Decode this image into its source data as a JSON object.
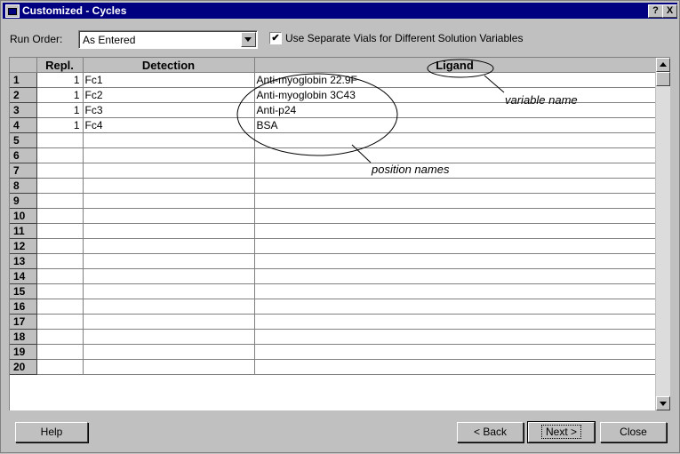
{
  "window": {
    "title": "Customized - Cycles",
    "help_btn": "?",
    "close_btn": "X"
  },
  "run_order": {
    "label": "Run Order:",
    "value": "As Entered"
  },
  "separate_vials": {
    "checked": true,
    "mark": "✔",
    "label": "Use Separate Vials for Different Solution Variables"
  },
  "table": {
    "headers": [
      "",
      "Repl.",
      "Detection",
      "Ligand"
    ],
    "rows": [
      {
        "n": "1",
        "repl": "1",
        "detection": "Fc1",
        "ligand": "Anti-myoglobin 22.9F"
      },
      {
        "n": "2",
        "repl": "1",
        "detection": "Fc2",
        "ligand": "Anti-myoglobin 3C43"
      },
      {
        "n": "3",
        "repl": "1",
        "detection": "Fc3",
        "ligand": "Anti-p24"
      },
      {
        "n": "4",
        "repl": "1",
        "detection": "Fc4",
        "ligand": "BSA"
      },
      {
        "n": "5",
        "repl": "",
        "detection": "",
        "ligand": ""
      },
      {
        "n": "6",
        "repl": "",
        "detection": "",
        "ligand": ""
      },
      {
        "n": "7",
        "repl": "",
        "detection": "",
        "ligand": ""
      },
      {
        "n": "8",
        "repl": "",
        "detection": "",
        "ligand": ""
      },
      {
        "n": "9",
        "repl": "",
        "detection": "",
        "ligand": ""
      },
      {
        "n": "10",
        "repl": "",
        "detection": "",
        "ligand": ""
      },
      {
        "n": "11",
        "repl": "",
        "detection": "",
        "ligand": ""
      },
      {
        "n": "12",
        "repl": "",
        "detection": "",
        "ligand": ""
      },
      {
        "n": "13",
        "repl": "",
        "detection": "",
        "ligand": ""
      },
      {
        "n": "14",
        "repl": "",
        "detection": "",
        "ligand": ""
      },
      {
        "n": "15",
        "repl": "",
        "detection": "",
        "ligand": ""
      },
      {
        "n": "16",
        "repl": "",
        "detection": "",
        "ligand": ""
      },
      {
        "n": "17",
        "repl": "",
        "detection": "",
        "ligand": ""
      },
      {
        "n": "18",
        "repl": "",
        "detection": "",
        "ligand": ""
      },
      {
        "n": "19",
        "repl": "",
        "detection": "",
        "ligand": ""
      },
      {
        "n": "20",
        "repl": "",
        "detection": "",
        "ligand": ""
      }
    ]
  },
  "annotations": {
    "variable_name": "variable name",
    "position_names": "position names"
  },
  "buttons": {
    "help": "Help",
    "back": "< Back",
    "next": "Next >",
    "close": "Close"
  }
}
